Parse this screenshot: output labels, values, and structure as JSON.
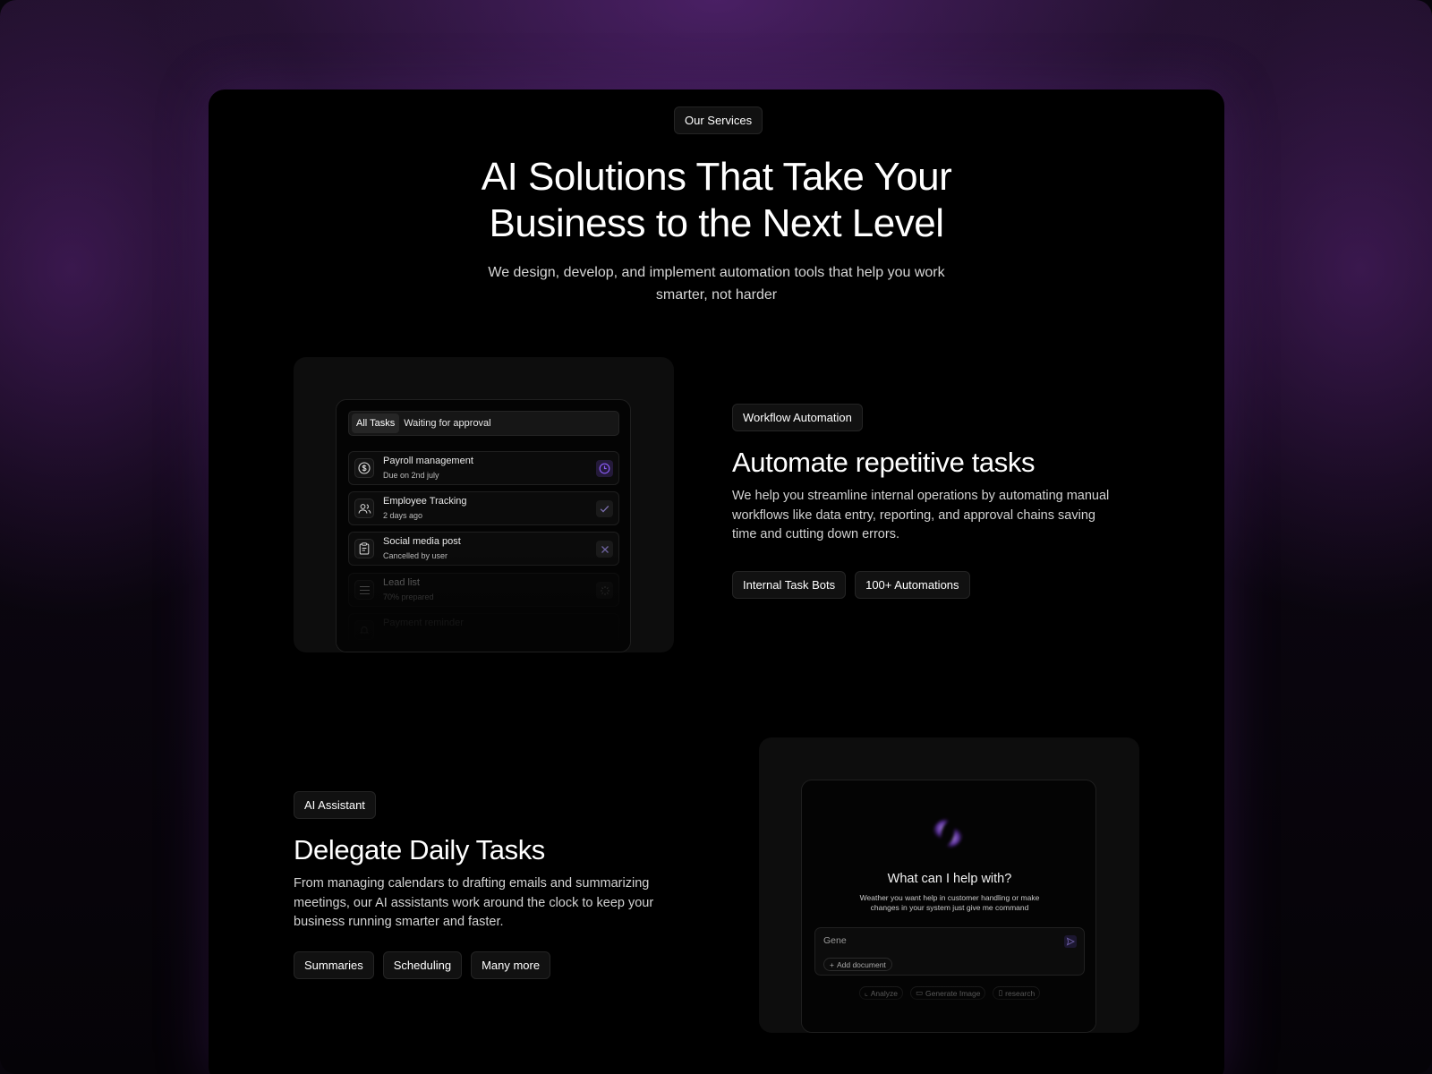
{
  "header": {
    "badge": "Our Services",
    "title_line1": "AI Solutions That Take Your",
    "title_line2": "Business to the Next Level",
    "subtitle": "We design, develop, and implement automation tools that help you work smarter, not harder"
  },
  "workflow": {
    "badge": "Workflow Automation",
    "title": "Automate repetitive tasks",
    "description": "We help you streamline internal operations by automating manual workflows like data entry, reporting, and approval chains saving time and cutting down errors.",
    "tags": [
      "Internal Task Bots",
      "100+ Automations"
    ],
    "tabs": [
      "All Tasks",
      "Waiting for approval"
    ],
    "tasks": [
      {
        "title": "Payroll management",
        "meta": "Due on 2nd july",
        "icon": "dollar-icon",
        "status": "clock-icon"
      },
      {
        "title": "Employee Tracking",
        "meta": "2 days ago",
        "icon": "users-icon",
        "status": "check-icon"
      },
      {
        "title": "Social media post",
        "meta": "Cancelled by user",
        "icon": "clipboard-icon",
        "status": "x-icon"
      },
      {
        "title": "Lead list",
        "meta": "70% prepared",
        "icon": "list-icon",
        "status": "spinner-icon"
      },
      {
        "title": "Payment reminder",
        "meta": "",
        "icon": "bell-icon",
        "status": ""
      }
    ]
  },
  "assistant": {
    "badge": "AI Assistant",
    "title": "Delegate Daily Tasks",
    "description": "From managing calendars to drafting emails and summarizing meetings, our AI assistants work around the clock to keep your business running smarter and faster.",
    "tags": [
      "Summaries",
      "Scheduling",
      "Many more"
    ],
    "chat_title": "What can I help with?",
    "chat_sub": "Weather you want help in  customer handling or make changes in your system just give me command",
    "input_value": "Gene",
    "add_document": "Add document",
    "quick_actions": [
      "Analyze",
      "Generate Image",
      "research"
    ]
  },
  "colors": {
    "accent": "#8b5cf6",
    "background": "#000000",
    "card": "#0d0d0d"
  }
}
